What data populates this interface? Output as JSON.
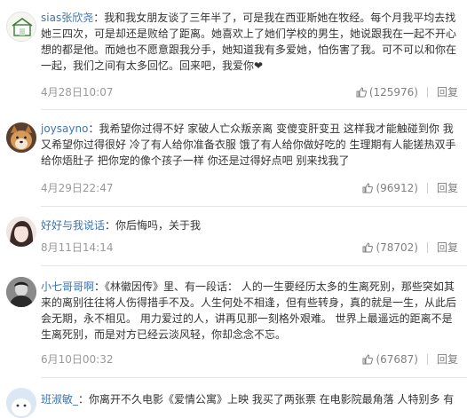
{
  "comments": [
    {
      "username": "sias张欣尧",
      "text": "我和我女朋友谈了三年半了，可是我在西亚斯她在牧经。每个月我平均去找她三四次，可是却还是败给了距离。她喜欢上了她们学校的男生，她说跟我在一起不开心想的都是他。而她也不愿意跟我分手，她知道我有多爱她，怕伤害了我。可不可以和你在一起，我们之间有太多回忆。回来吧，我爱你❤",
      "time": "4月28日10:07",
      "likes": "(125976)",
      "reply": "回复"
    },
    {
      "username": "joysayno",
      "text": "我希望你过得不好 家破人亡众叛亲离 变傻变肝变丑 这样我才能触碰到你 我又希望你过得很好 冷了有人给你准备衣服 饿了有人给你做好吃的 生理期有人能搓热双手给你焐肚子 把你宠的像个孩子一样 你还是过得好点吧 别来找我了",
      "time": "4月29日22:47",
      "likes": "(96912)",
      "reply": "回复"
    },
    {
      "username": "好好与我说话",
      "text": "你后悔吗，关于我",
      "time": "8月11日14:14",
      "likes": "(78702)",
      "reply": "回复"
    },
    {
      "username": "小七哥哥啊",
      "text": "《林徽因传》里、有一段话：  人的一生要经历太多的生离死别，那些突如其来的离别往往将人伤得措手不及。人生何处不相逢，但有些转身，真的就是一生，从此后会无期，永不相见。  用力爱过的人，讲再见那一刻格外艰难。  世界上最遥远的距离不是生离死别，而是对方已经云淡风轻，你却念念不忘。",
      "time": "6月10日00:32",
      "likes": "(67687)",
      "reply": "回复"
    },
    {
      "username": "班淑敏_",
      "text": "你离开不久电影《爱情公寓》上映 我买了两张票 在电影院最角落 人特别多 有",
      "time": "",
      "likes": "",
      "reply": ""
    }
  ],
  "colors": {
    "username": "#3d75b4",
    "meta": "#999999",
    "text": "#333333"
  },
  "icons": {
    "like": "thumbs-up-icon"
  }
}
